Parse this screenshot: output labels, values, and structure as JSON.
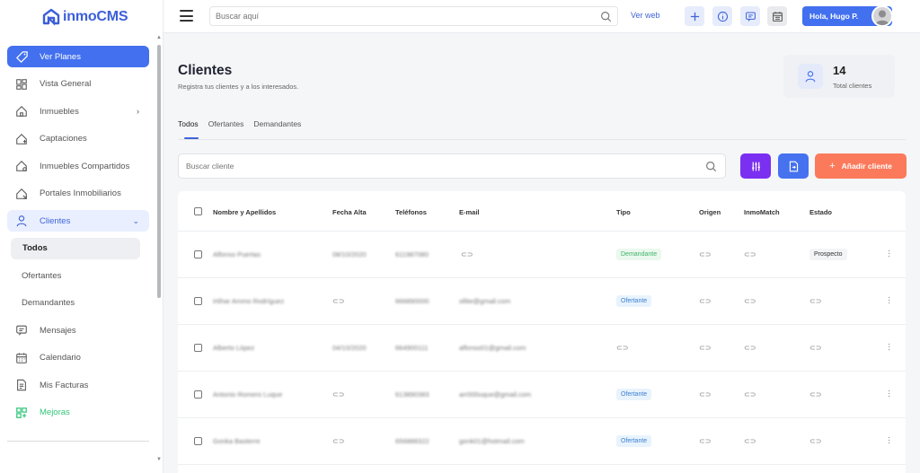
{
  "app": {
    "name": "inmoCMS"
  },
  "sidebar": {
    "items": [
      {
        "label": "Ver Planes",
        "icon": "tag-icon"
      },
      {
        "label": "Vista General",
        "icon": "dashboard-icon"
      },
      {
        "label": "Inmuebles",
        "icon": "home-icon"
      },
      {
        "label": "Captaciones",
        "icon": "home-plus-icon"
      },
      {
        "label": "Inmuebles Compartidos",
        "icon": "home-share-icon"
      },
      {
        "label": "Portales Inmobiliarios",
        "icon": "home-portal-icon"
      },
      {
        "label": "Clientes",
        "icon": "user-icon"
      },
      {
        "label": "Todos"
      },
      {
        "label": "Ofertantes"
      },
      {
        "label": "Demandantes"
      },
      {
        "label": "Mensajes",
        "icon": "message-icon"
      },
      {
        "label": "Calendario",
        "icon": "calendar-icon"
      },
      {
        "label": "Mis Facturas",
        "icon": "invoice-icon"
      },
      {
        "label": "Mejoras",
        "icon": "grid-plus-icon"
      }
    ]
  },
  "topbar": {
    "search_placeholder": "Buscar aquí",
    "ver_web": "Ver web",
    "user_greeting": "Hola, Hugo P."
  },
  "page": {
    "title": "Clientes",
    "subtitle": "Registra tus clientes y a los interesados.",
    "stat": {
      "value": "14",
      "label": "Total clientes"
    },
    "tabs": [
      "Todos",
      "Ofertantes",
      "Demandantes"
    ],
    "search_placeholder": "Buscar cliente",
    "add_button": "Añadir cliente"
  },
  "table": {
    "headers": [
      "Nombre y Apellidos",
      "Fecha Alta",
      "Teléfonos",
      "E-mail",
      "Tipo",
      "Origen",
      "InmoMatch",
      "Estado"
    ],
    "rows": [
      {
        "name": "Alfonso Puertas",
        "fecha": "08/10/2020",
        "tel": "611987080",
        "email": "",
        "tipo": "Demandante",
        "estado": "Prospecto"
      },
      {
        "name": "Irtihar Ammo Rodríguez",
        "fecha": "",
        "tel": "666890000",
        "email": "ollite@gmail.com",
        "tipo": "Ofertante",
        "estado": ""
      },
      {
        "name": "Alberto López",
        "fecha": "04/10/2020",
        "tel": "664900111",
        "email": "alfonso01@gmail.com",
        "tipo": "",
        "estado": ""
      },
      {
        "name": "Antonio Romero Luque",
        "fecha": "",
        "tel": "613890383",
        "email": "arr000uque@gmail.com",
        "tipo": "Ofertante",
        "estado": ""
      },
      {
        "name": "Gonka Basterre",
        "fecha": "",
        "tel": "656888322",
        "email": "gonk01@hotmail.com",
        "tipo": "Ofertante",
        "estado": ""
      }
    ]
  },
  "colors": {
    "primary": "#4270ef",
    "purple": "#7b2ff0",
    "orange": "#fb7a5c",
    "green": "#32c67a"
  }
}
